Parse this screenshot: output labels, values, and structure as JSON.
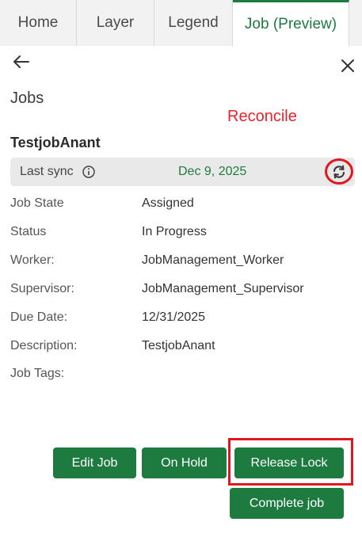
{
  "tabs": [
    {
      "label": "Home"
    },
    {
      "label": "Layer"
    },
    {
      "label": "Legend"
    },
    {
      "label": "Job (Preview)",
      "active": true
    }
  ],
  "header": {
    "back_icon": "arrow-left-icon",
    "close_icon": "close-icon"
  },
  "panel": {
    "title": "Jobs",
    "annotation": "Reconcile",
    "job_name": "TestjobAnant"
  },
  "sync": {
    "label": "Last sync",
    "info_icon": "info-icon",
    "date": "Dec 9, 2025",
    "reconcile_icon": "sync-icon"
  },
  "details": [
    {
      "label": "Job State",
      "value": "Assigned"
    },
    {
      "label": "Status",
      "value": "In Progress"
    },
    {
      "label": "Worker:",
      "value": "JobManagement_Worker"
    },
    {
      "label": "Supervisor:",
      "value": "JobManagement_Supervisor"
    },
    {
      "label": "Due Date:",
      "value": "12/31/2025"
    },
    {
      "label": "Description:",
      "value": "TestjobAnant"
    },
    {
      "label": "Job Tags:",
      "value": ""
    }
  ],
  "actions": {
    "edit": "Edit Job",
    "hold": "On Hold",
    "release": "Release Lock",
    "complete": "Complete job"
  },
  "colors": {
    "accent": "#1e7b3f",
    "highlight": "#e0171f"
  }
}
